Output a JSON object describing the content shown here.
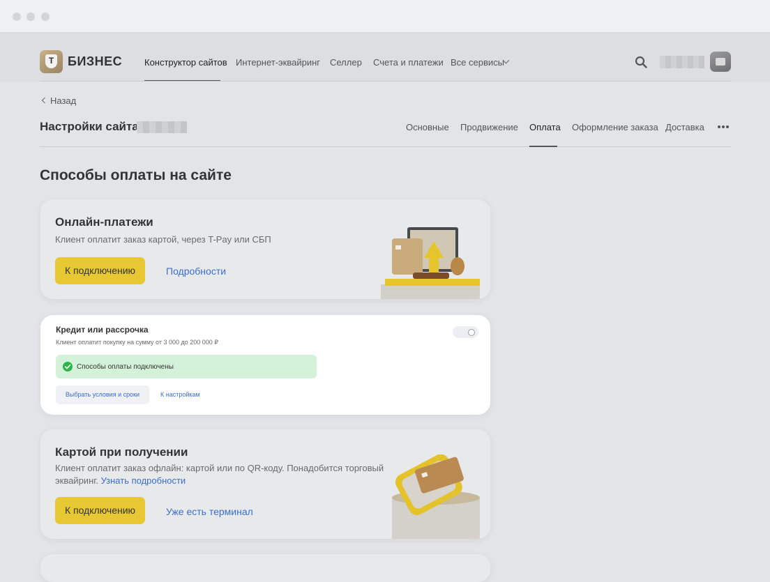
{
  "header": {
    "brand": "БИЗНЕС",
    "logo_letter": "Т",
    "nav": [
      {
        "label": "Конструктор сайтов"
      },
      {
        "label": "Интернет-эквайринг"
      },
      {
        "label": "Селлер"
      },
      {
        "label": "Счета и платежи"
      },
      {
        "label": "Все сервисы"
      }
    ]
  },
  "page": {
    "back_label": "Назад",
    "title": "Настройки сайта",
    "tabs": [
      {
        "label": "Основные"
      },
      {
        "label": "Продвижение"
      },
      {
        "label": "Оплата"
      },
      {
        "label": "Оформление заказа"
      },
      {
        "label": "Доставка"
      }
    ]
  },
  "section": {
    "title": "Способы оплаты на сайте"
  },
  "online": {
    "title": "Онлайн-платежи",
    "description": "Клиент оплатит заказ картой, через T-Pay или СБП",
    "connect_button": "К подключению",
    "details_link": "Подробности"
  },
  "credit": {
    "title": "Кредит или рассрочка",
    "description": "Клиент оплатит покупку на сумму от 3 000 до 200 000 ₽",
    "status": "Способы оплаты подключены",
    "terms_button": "Выбрать условия и сроки",
    "settings_link": "К настройкам"
  },
  "card_on_delivery": {
    "title": "Картой при получении",
    "description_line1": "Клиент оплатит заказ офлайн: картой или по QR-коду. Понадобится торговый",
    "description_line2": "эквайринг.",
    "learn_more_link": "Узнать подробности",
    "connect_button": "К подключению",
    "terminal_link": "Уже есть терминал"
  },
  "colors": {
    "accent_yellow": "#e7c832",
    "link_blue": "#3a6fc8",
    "success_green": "#d4f2d9",
    "check_green": "#2db34a"
  }
}
